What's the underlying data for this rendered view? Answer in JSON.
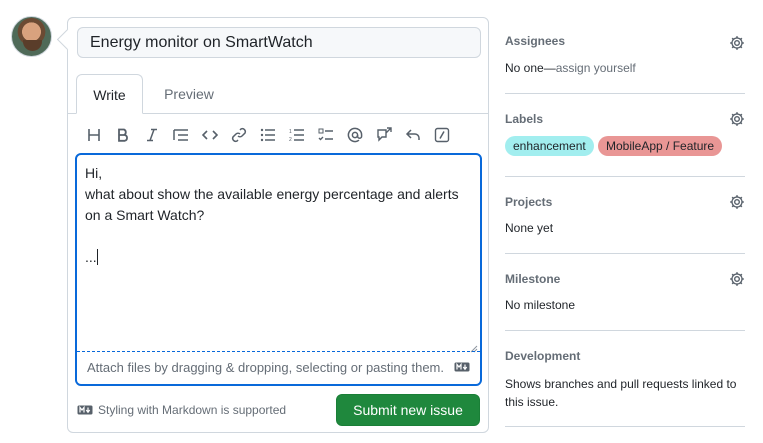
{
  "issue": {
    "title_value": "Energy monitor on SmartWatch",
    "tabs": {
      "write": "Write",
      "preview": "Preview"
    },
    "body_lines": [
      "Hi,",
      "what about show the available energy percentage and alerts",
      "on a Smart Watch?",
      "",
      "..."
    ],
    "attach_hint": "Attach files by dragging & dropping, selecting or pasting them.",
    "markdown_note": "Styling with Markdown is supported",
    "submit_label": "Submit new issue"
  },
  "toolbar": [
    "heading-icon",
    "bold-icon",
    "italic-icon",
    "quote-icon",
    "code-icon",
    "link-icon",
    "bulleted-list-icon",
    "numbered-list-icon",
    "task-list-icon",
    "mention-icon",
    "cross-reference-icon",
    "reply-icon",
    "slash-commands-icon"
  ],
  "sidebar": {
    "assignees": {
      "title": "Assignees",
      "value_prefix": "No one—",
      "value_link": "assign yourself"
    },
    "labels": {
      "title": "Labels",
      "items": [
        {
          "name": "enhancement",
          "color": "#a2eeef"
        },
        {
          "name": "MobileApp / Feature",
          "color": "#e99695"
        }
      ]
    },
    "projects": {
      "title": "Projects",
      "value": "None yet"
    },
    "milestone": {
      "title": "Milestone",
      "value": "No milestone"
    },
    "development": {
      "title": "Development",
      "value": "Shows branches and pull requests linked to this issue."
    }
  },
  "colors": {
    "accent_blue": "#0969da",
    "submit_green": "#1f883d"
  }
}
